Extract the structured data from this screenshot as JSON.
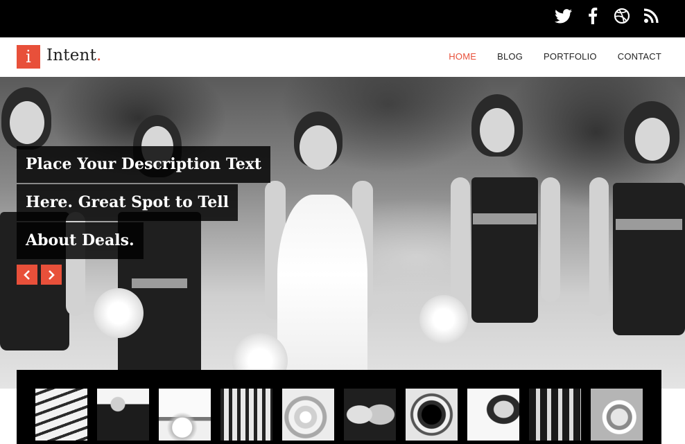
{
  "social": {
    "icons": [
      "twitter-icon",
      "facebook-icon",
      "dribbble-icon",
      "rss-icon"
    ]
  },
  "brand": {
    "logo_letter": "i",
    "name": "Intent",
    "dot": ".",
    "accent_color": "#e8503a"
  },
  "nav": {
    "items": [
      {
        "label": "HOME",
        "active": true
      },
      {
        "label": "BLOG",
        "active": false
      },
      {
        "label": "PORTFOLIO",
        "active": false
      },
      {
        "label": "CONTACT",
        "active": false
      }
    ]
  },
  "hero": {
    "caption_lines": [
      "Place Your Description Text",
      "Here. Great Spot to Tell",
      "About Deals."
    ],
    "prev_icon": "chevron-left-icon",
    "next_icon": "chevron-right-icon"
  },
  "thumbnails": {
    "items": [
      "keyboard-thumbnail",
      "man-sitting-thumbnail",
      "flowers-thumbnail",
      "wedding-party-thumbnail",
      "rose-thumbnail",
      "couple-thumbnail",
      "rings-thumbnail",
      "bride-portrait-thumbnail",
      "groomsmen-thumbnail",
      "ring-closeup-thumbnail"
    ]
  }
}
